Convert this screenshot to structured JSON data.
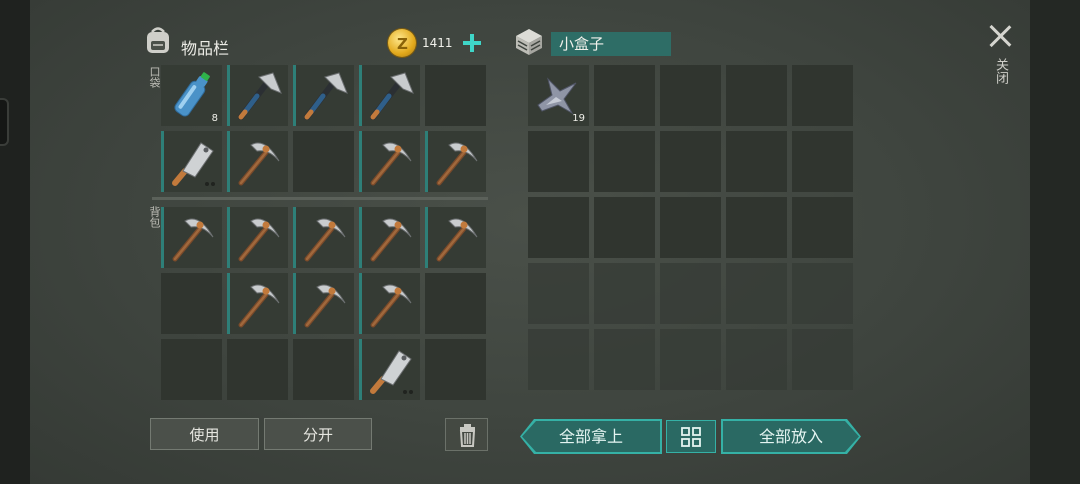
{
  "inventory": {
    "title": "物品栏",
    "pocket_label": "口袋",
    "backpack_label": "背包",
    "coins": "1411"
  },
  "container": {
    "name": "小盒子"
  },
  "close_label": "关闭",
  "buttons": {
    "use": "使用",
    "split": "分开",
    "take_all": "全部拿上",
    "put_all": "全部放入"
  },
  "pocket_slots": [
    {
      "item": "water-bottle",
      "qty": "8"
    },
    {
      "item": "hatchet",
      "qty": ""
    },
    {
      "item": "hatchet",
      "qty": ""
    },
    {
      "item": "hatchet",
      "qty": ""
    },
    {
      "item": "",
      "qty": ""
    },
    {
      "item": "cleaver",
      "qty": ""
    },
    {
      "item": "pickaxe",
      "qty": ""
    },
    {
      "item": "",
      "qty": ""
    },
    {
      "item": "pickaxe",
      "qty": ""
    },
    {
      "item": "pickaxe",
      "qty": ""
    }
  ],
  "backpack_slots": [
    {
      "item": "pickaxe",
      "qty": ""
    },
    {
      "item": "pickaxe",
      "qty": ""
    },
    {
      "item": "pickaxe",
      "qty": ""
    },
    {
      "item": "pickaxe",
      "qty": ""
    },
    {
      "item": "pickaxe",
      "qty": ""
    },
    {
      "item": "",
      "qty": ""
    },
    {
      "item": "pickaxe",
      "qty": ""
    },
    {
      "item": "pickaxe",
      "qty": ""
    },
    {
      "item": "pickaxe",
      "qty": ""
    },
    {
      "item": "",
      "qty": ""
    },
    {
      "item": "",
      "qty": ""
    },
    {
      "item": "",
      "qty": ""
    },
    {
      "item": "",
      "qty": ""
    },
    {
      "item": "cleaver",
      "qty": ""
    },
    {
      "item": "",
      "qty": ""
    }
  ],
  "container_slots": [
    {
      "item": "metal-scrap",
      "qty": "19"
    }
  ],
  "colors": {
    "accent": "#2e7f78",
    "button_teal": "#2a6963",
    "coin": "#e2a91c"
  }
}
